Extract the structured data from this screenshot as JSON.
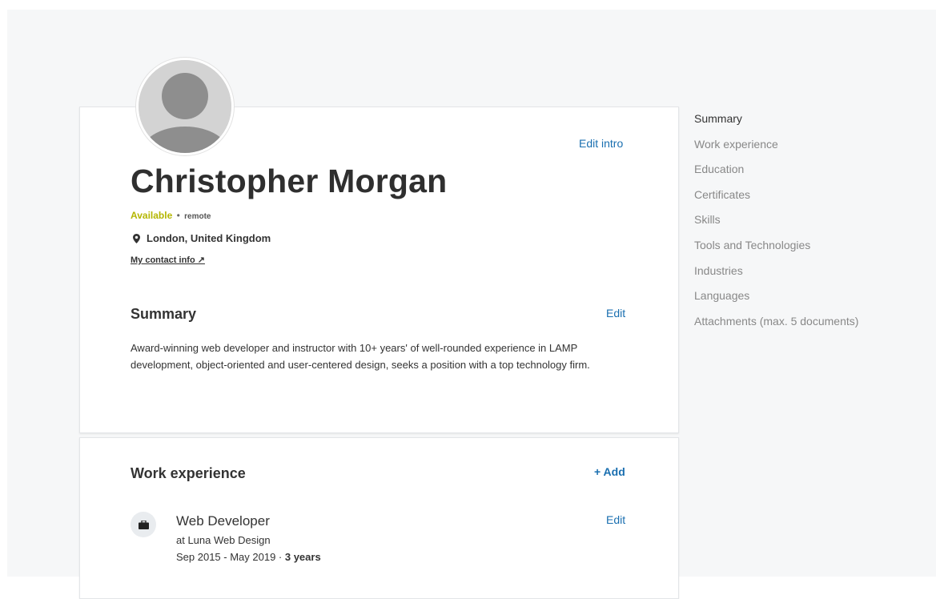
{
  "profile": {
    "name": "Christopher Morgan",
    "edit_intro_label": "Edit intro",
    "availability": "Available",
    "availability_color": "#b4b600",
    "separator": "•",
    "work_mode": "remote",
    "location": "London, United Kingdom",
    "location_icon": "map-pin-icon",
    "contact_label": "My contact info ↗"
  },
  "summary": {
    "title": "Summary",
    "edit_label": "Edit",
    "text": "Award-winning web developer and instructor with 10+ years' of well-rounded experience in LAMP development, object-oriented and user-centered design, seeks a position with a top technology firm."
  },
  "work_experience": {
    "title": "Work experience",
    "add_label": "+ Add",
    "items": [
      {
        "icon": "briefcase-icon",
        "title": "Web Developer",
        "company": "at Luna Web Design",
        "dates": "Sep 2015 - May 2019 · ",
        "duration": "3 years",
        "edit_label": "Edit"
      }
    ]
  },
  "side_nav": {
    "items": [
      {
        "label": "Summary"
      },
      {
        "label": "Work experience"
      },
      {
        "label": "Education"
      },
      {
        "label": "Certificates"
      },
      {
        "label": "Skills"
      },
      {
        "label": "Tools and Technologies"
      },
      {
        "label": "Industries"
      },
      {
        "label": "Languages"
      },
      {
        "label": "Attachments (max. 5 documents)"
      }
    ]
  },
  "colors": {
    "accent": "#1a6fb0",
    "page_background": "#f6f7f8"
  }
}
